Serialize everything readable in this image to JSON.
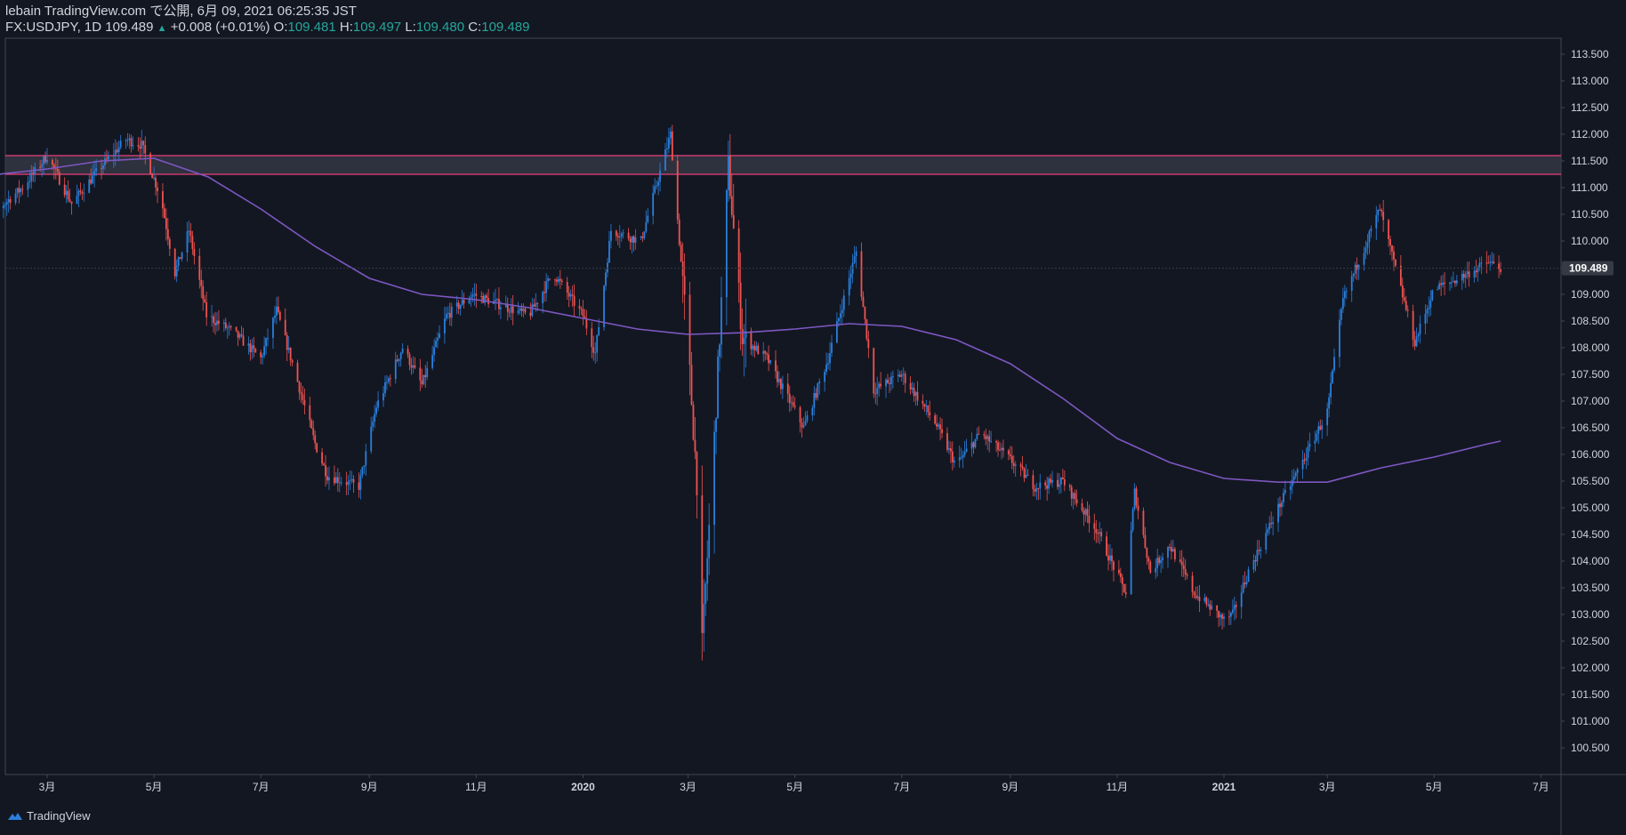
{
  "header": {
    "published": "lebain TradingView.com で公開, 6月 09, 2021 06:25:35 JST",
    "symbol": "FX:USDJPY, 1D",
    "last": "109.489",
    "change": "+0.008 (+0.01%)",
    "o_label": "O:",
    "o_value": "109.481",
    "h_label": "H:",
    "h_value": "109.497",
    "l_label": "L:",
    "l_value": "109.480",
    "c_label": "C:",
    "c_value": "109.489"
  },
  "footer": {
    "brand": "TradingView"
  },
  "colors": {
    "background": "#131722",
    "up": "#2a7fdc",
    "down": "#ef5350",
    "ma": "#7e57c2",
    "zone_line": "#e9407a",
    "zone_fill": "#3a3d4a",
    "axis_text": "#d1d4dc",
    "grid": "#2a2e39"
  },
  "chart_data": {
    "type": "candlestick",
    "symbol": "FX:USDJPY",
    "timeframe": "1D",
    "ylim": [
      100.0,
      113.8
    ],
    "y_ticks": [
      "100.500",
      "101.000",
      "101.500",
      "102.000",
      "102.500",
      "103.000",
      "103.500",
      "104.000",
      "104.500",
      "105.000",
      "105.500",
      "106.000",
      "106.500",
      "107.000",
      "107.500",
      "108.000",
      "108.500",
      "109.000",
      "109.500",
      "110.000",
      "110.500",
      "111.000",
      "111.500",
      "112.000",
      "112.500",
      "113.000",
      "113.500"
    ],
    "x_ticks": [
      "3月",
      "5月",
      "7月",
      "9月",
      "11月",
      "2020",
      "3月",
      "5月",
      "7月",
      "9月",
      "11月",
      "2021",
      "3月",
      "5月",
      "7月"
    ],
    "x_tick_bold": [
      "2020",
      "2021"
    ],
    "last_price_label": "109.489",
    "resistance_zone": [
      111.25,
      111.6
    ],
    "moving_average": {
      "x": [
        "2019-02-01",
        "2019-03-01",
        "2019-04-01",
        "2019-05-01",
        "2019-06-01",
        "2019-07-01",
        "2019-08-01",
        "2019-09-01",
        "2019-10-01",
        "2019-11-01",
        "2019-12-01",
        "2020-01-01",
        "2020-02-01",
        "2020-03-01",
        "2020-04-01",
        "2020-05-01",
        "2020-06-01",
        "2020-07-01",
        "2020-08-01",
        "2020-09-01",
        "2020-10-01",
        "2020-11-01",
        "2020-12-01",
        "2021-01-01",
        "2021-02-01",
        "2021-03-01",
        "2021-04-01",
        "2021-05-01",
        "2021-06-01",
        "2021-06-08"
      ],
      "y": [
        111.25,
        111.35,
        111.5,
        111.55,
        111.2,
        110.6,
        109.9,
        109.3,
        109.0,
        108.9,
        108.75,
        108.55,
        108.35,
        108.25,
        108.28,
        108.35,
        108.45,
        108.4,
        108.15,
        107.7,
        107.05,
        106.3,
        105.85,
        105.55,
        105.48,
        105.48,
        105.75,
        105.95,
        106.2,
        106.25
      ]
    },
    "price_path": {
      "x": [
        "2019-01-21",
        "2019-02-01",
        "2019-02-15",
        "2019-03-01",
        "2019-03-15",
        "2019-04-01",
        "2019-04-15",
        "2019-04-24",
        "2019-05-05",
        "2019-05-13",
        "2019-05-21",
        "2019-05-31",
        "2019-06-15",
        "2019-07-01",
        "2019-07-10",
        "2019-07-20",
        "2019-08-01",
        "2019-08-08",
        "2019-08-26",
        "2019-09-05",
        "2019-09-20",
        "2019-10-01",
        "2019-10-15",
        "2019-10-30",
        "2019-11-15",
        "2019-12-01",
        "2019-12-15",
        "2020-01-01",
        "2020-01-08",
        "2020-01-17",
        "2020-02-03",
        "2020-02-20",
        "2020-03-01",
        "2020-03-06",
        "2020-03-09",
        "2020-03-16",
        "2020-03-24",
        "2020-04-01",
        "2020-04-15",
        "2020-05-06",
        "2020-05-20",
        "2020-06-05",
        "2020-06-15",
        "2020-07-01",
        "2020-07-20",
        "2020-08-01",
        "2020-08-15",
        "2020-09-01",
        "2020-09-15",
        "2020-10-01",
        "2020-10-20",
        "2020-11-06",
        "2020-11-11",
        "2020-11-20",
        "2020-12-01",
        "2020-12-15",
        "2021-01-01",
        "2021-01-06",
        "2021-01-15",
        "2021-02-01",
        "2021-02-17",
        "2021-03-01",
        "2021-03-10",
        "2021-03-31",
        "2021-04-20",
        "2021-05-01",
        "2021-05-15",
        "2021-06-01",
        "2021-06-08"
      ],
      "y": [
        109.7,
        110.6,
        111.0,
        111.6,
        110.7,
        111.4,
        111.9,
        111.8,
        110.8,
        109.4,
        110.2,
        108.6,
        108.3,
        107.8,
        108.7,
        107.6,
        106.2,
        105.6,
        105.4,
        106.9,
        108.0,
        107.3,
        108.6,
        109.0,
        108.8,
        108.6,
        109.4,
        108.6,
        107.9,
        110.2,
        110.0,
        112.0,
        108.0,
        105.5,
        102.4,
        106.3,
        111.4,
        108.2,
        107.8,
        106.5,
        107.8,
        109.8,
        107.2,
        107.5,
        106.6,
        105.8,
        106.4,
        105.9,
        105.4,
        105.5,
        104.6,
        103.4,
        105.3,
        103.8,
        104.3,
        103.4,
        102.9,
        103.0,
        103.8,
        105.0,
        106.0,
        106.8,
        108.9,
        110.6,
        108.1,
        109.1,
        109.3,
        109.6,
        109.5
      ]
    }
  }
}
